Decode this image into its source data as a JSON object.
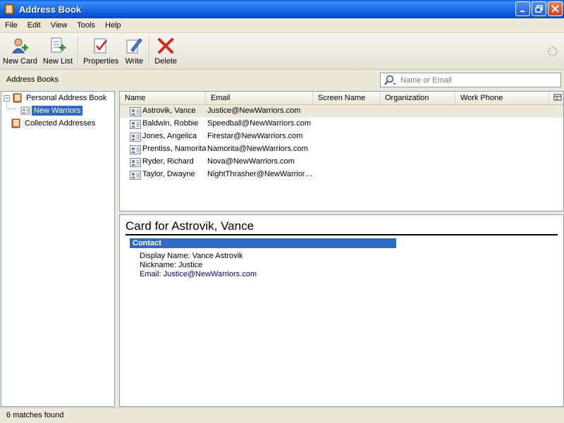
{
  "window": {
    "title": "Address Book"
  },
  "menu": [
    "File",
    "Edit",
    "View",
    "Tools",
    "Help"
  ],
  "toolbar": {
    "new_card": "New Card",
    "new_list": "New List",
    "properties": "Properties",
    "write": "Write",
    "delete": "Delete"
  },
  "sidebar": {
    "header": "Address Books",
    "books": [
      {
        "label": "Personal Address Book"
      },
      {
        "label": "New Warriors"
      },
      {
        "label": "Collected Addresses"
      }
    ]
  },
  "search": {
    "placeholder": "Name or Email"
  },
  "columns": [
    "Name",
    "Email",
    "Screen Name",
    "Organization",
    "Work Phone"
  ],
  "contacts": [
    {
      "name": "Astrovik, Vance",
      "email": "Justice@NewWarriors.com"
    },
    {
      "name": "Baldwin, Robbie",
      "email": "Speedball@NewWarriors.com"
    },
    {
      "name": "Jones, Angelica",
      "email": "Firestar@NewWarriors.com"
    },
    {
      "name": "Prentiss, Namorita",
      "email": "Namorita@NewWarriors.com"
    },
    {
      "name": "Ryder, Richard",
      "email": "Nova@NewWarriors.com"
    },
    {
      "name": "Taylor, Dwayne",
      "email": "NightThrasher@NewWarrior…"
    }
  ],
  "card": {
    "title": "Card for Astrovik, Vance",
    "section": "Contact",
    "display_name": "Display Name: Vance Astrovik",
    "nickname": "Nickname: Justice",
    "email": "Email: Justice@NewWarriors.com"
  },
  "status": {
    "text": "6 matches found"
  },
  "colors": {
    "selection": "#316ac5",
    "titlebar": "#0a55d6",
    "window_bg": "#ece9d8"
  }
}
